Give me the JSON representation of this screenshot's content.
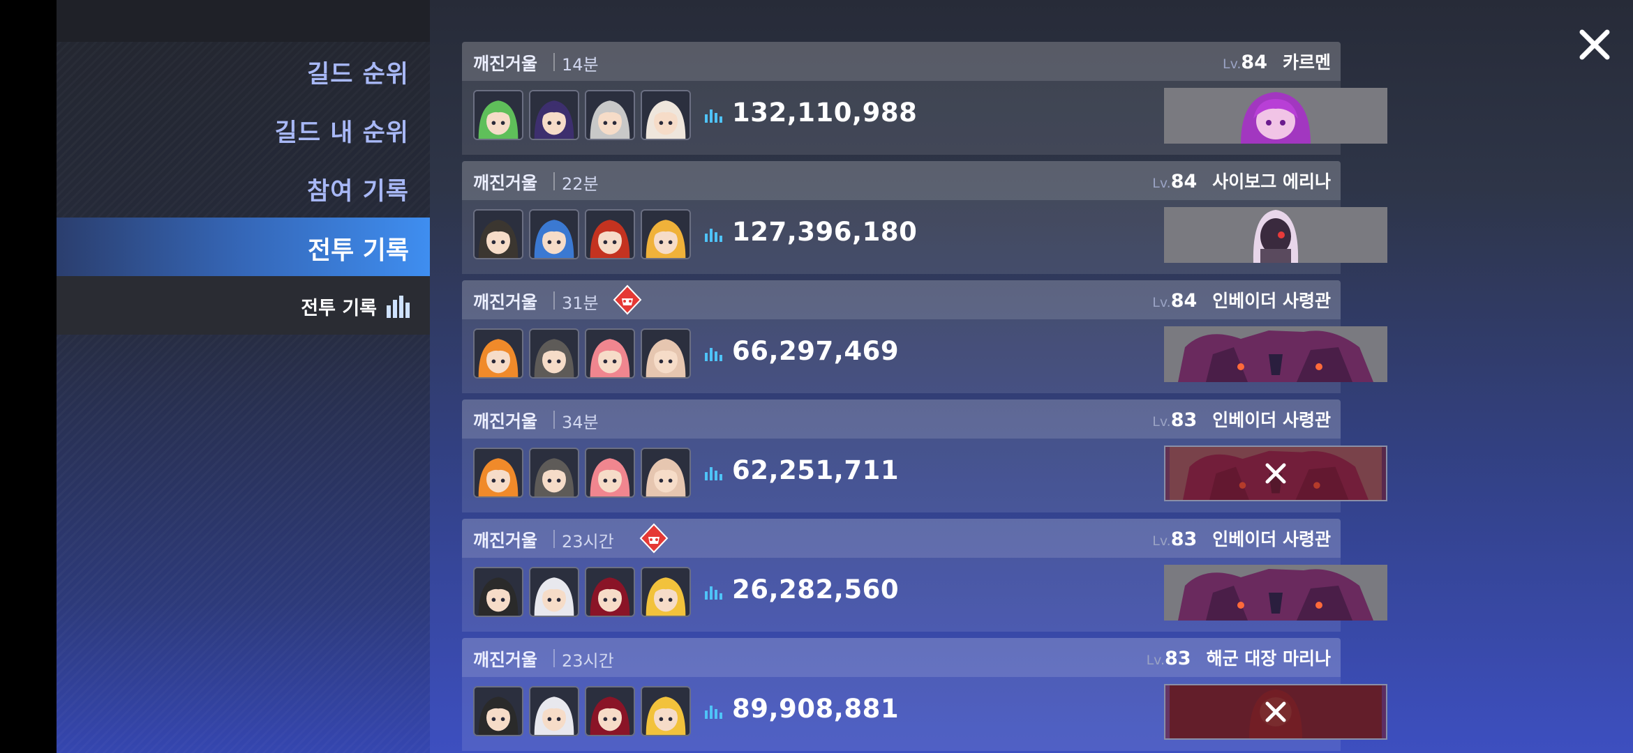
{
  "sidebar": {
    "items": [
      {
        "label": "길드 순위"
      },
      {
        "label": "길드 내 순위"
      },
      {
        "label": "참여 기록"
      },
      {
        "label": "전투 기록"
      }
    ],
    "sub_label": "전투 기록"
  },
  "records": [
    {
      "mode": "깨진거울",
      "time": "14분",
      "badge": false,
      "lv_tag": "Lv.",
      "level": "84",
      "boss": "카르멘",
      "score": "132,110,988",
      "boss_art": "carmen",
      "failed": false,
      "team": [
        "#5fbf5a",
        "#3d2f6e",
        "#c8c8c8",
        "#efe6dc"
      ]
    },
    {
      "mode": "깨진거울",
      "time": "22분",
      "badge": false,
      "lv_tag": "Lv.",
      "level": "84",
      "boss": "사이보그 에리나",
      "score": "127,396,180",
      "boss_art": "cyborg",
      "failed": false,
      "team": [
        "#3b3630",
        "#3b79d2",
        "#c43320",
        "#f0b23a"
      ]
    },
    {
      "mode": "깨진거울",
      "time": "31분",
      "badge": true,
      "lv_tag": "Lv.",
      "level": "84",
      "boss": "인베이더 사령관",
      "score": "66,297,469",
      "boss_art": "invader",
      "failed": false,
      "team": [
        "#f08a2a",
        "#5e5b58",
        "#f0868f",
        "#e6c6b0"
      ]
    },
    {
      "mode": "깨진거울",
      "time": "34분",
      "badge": false,
      "lv_tag": "Lv.",
      "level": "83",
      "boss": "인베이더 사령관",
      "score": "62,251,711",
      "boss_art": "invader",
      "failed": true,
      "team": [
        "#f08a2a",
        "#5e5b58",
        "#f0868f",
        "#e6c6b0"
      ]
    },
    {
      "mode": "깨진거울",
      "time": "23시간",
      "badge": true,
      "lv_tag": "Lv.",
      "level": "83",
      "boss": "인베이더 사령관",
      "score": "26,282,560",
      "boss_art": "invader",
      "failed": false,
      "team": [
        "#2a2a2a",
        "#e8e8ee",
        "#8a1427",
        "#f2c23c"
      ]
    },
    {
      "mode": "깨진거울",
      "time": "23시간",
      "badge": false,
      "lv_tag": "Lv.",
      "level": "83",
      "boss": "해군 대장 마리나",
      "score": "89,908,881",
      "boss_art": "marina",
      "failed": true,
      "team": [
        "#2a2a2a",
        "#e8e8ee",
        "#8a1427",
        "#f2c23c"
      ]
    }
  ],
  "colors": {
    "accent": "#3f8ef0",
    "score_icon": "#4fc3f7",
    "badge": "#e53935"
  }
}
